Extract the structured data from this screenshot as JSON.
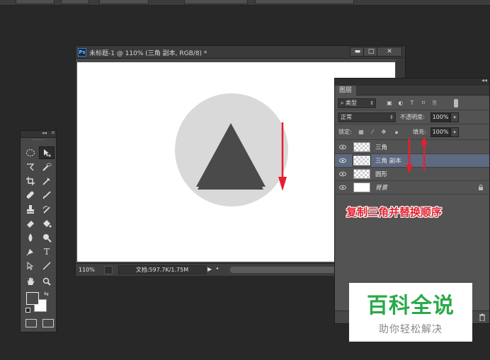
{
  "document": {
    "app_badge": "Ps",
    "title": "未标题-1 @ 110% (三角 副本, RGB/8) *",
    "window_buttons": {
      "minimize": "▬",
      "restore": "□",
      "close": "✕"
    },
    "zoom": "110%",
    "doc_info": "文档:597.7K/1.75M",
    "canvas_colors": {
      "circle": "#d9d9d9",
      "triangle": "#4a4a4a",
      "arrow": "#e5202e"
    }
  },
  "tools_panel": {
    "header_collapse": "◂◂",
    "header_close": "✕",
    "foreground_color": "#4a4a4a",
    "background_color": "#ffffff",
    "tools": [
      "marquee-icon",
      "move-icon",
      "lasso-icon",
      "quick-select-icon",
      "crop-icon",
      "eyedropper-icon",
      "healing-icon",
      "brush-icon",
      "stamp-icon",
      "history-brush-icon",
      "eraser-icon",
      "paint-bucket-icon",
      "blur-icon",
      "dodge-icon",
      "pen-icon",
      "text-icon",
      "path-select-icon",
      "line-icon",
      "hand-icon",
      "zoom-icon"
    ],
    "text_tool_glyph": "T"
  },
  "layers_panel": {
    "tab": "图层",
    "filter_label": "类型",
    "filter_icons": [
      "image-filter-icon",
      "adjustment-filter-icon",
      "T",
      "shape-filter-icon",
      "smart-filter-icon"
    ],
    "blend_mode": "正常",
    "opacity_label": "不透明度:",
    "opacity_value": "100%",
    "lock_label": "锁定:",
    "fill_label": "填充:",
    "fill_value": "100%",
    "layers": [
      {
        "name": "三角",
        "active": false
      },
      {
        "name": "三角 副本",
        "active": true
      },
      {
        "name": "圆形",
        "active": false
      },
      {
        "name": "背景",
        "active": false,
        "locked": true
      }
    ],
    "annotation": "复制三角并替换顺序",
    "annotation_color": "#e5202e"
  },
  "watermark": {
    "title": "百科全说",
    "subtitle": "助你轻松解决"
  }
}
